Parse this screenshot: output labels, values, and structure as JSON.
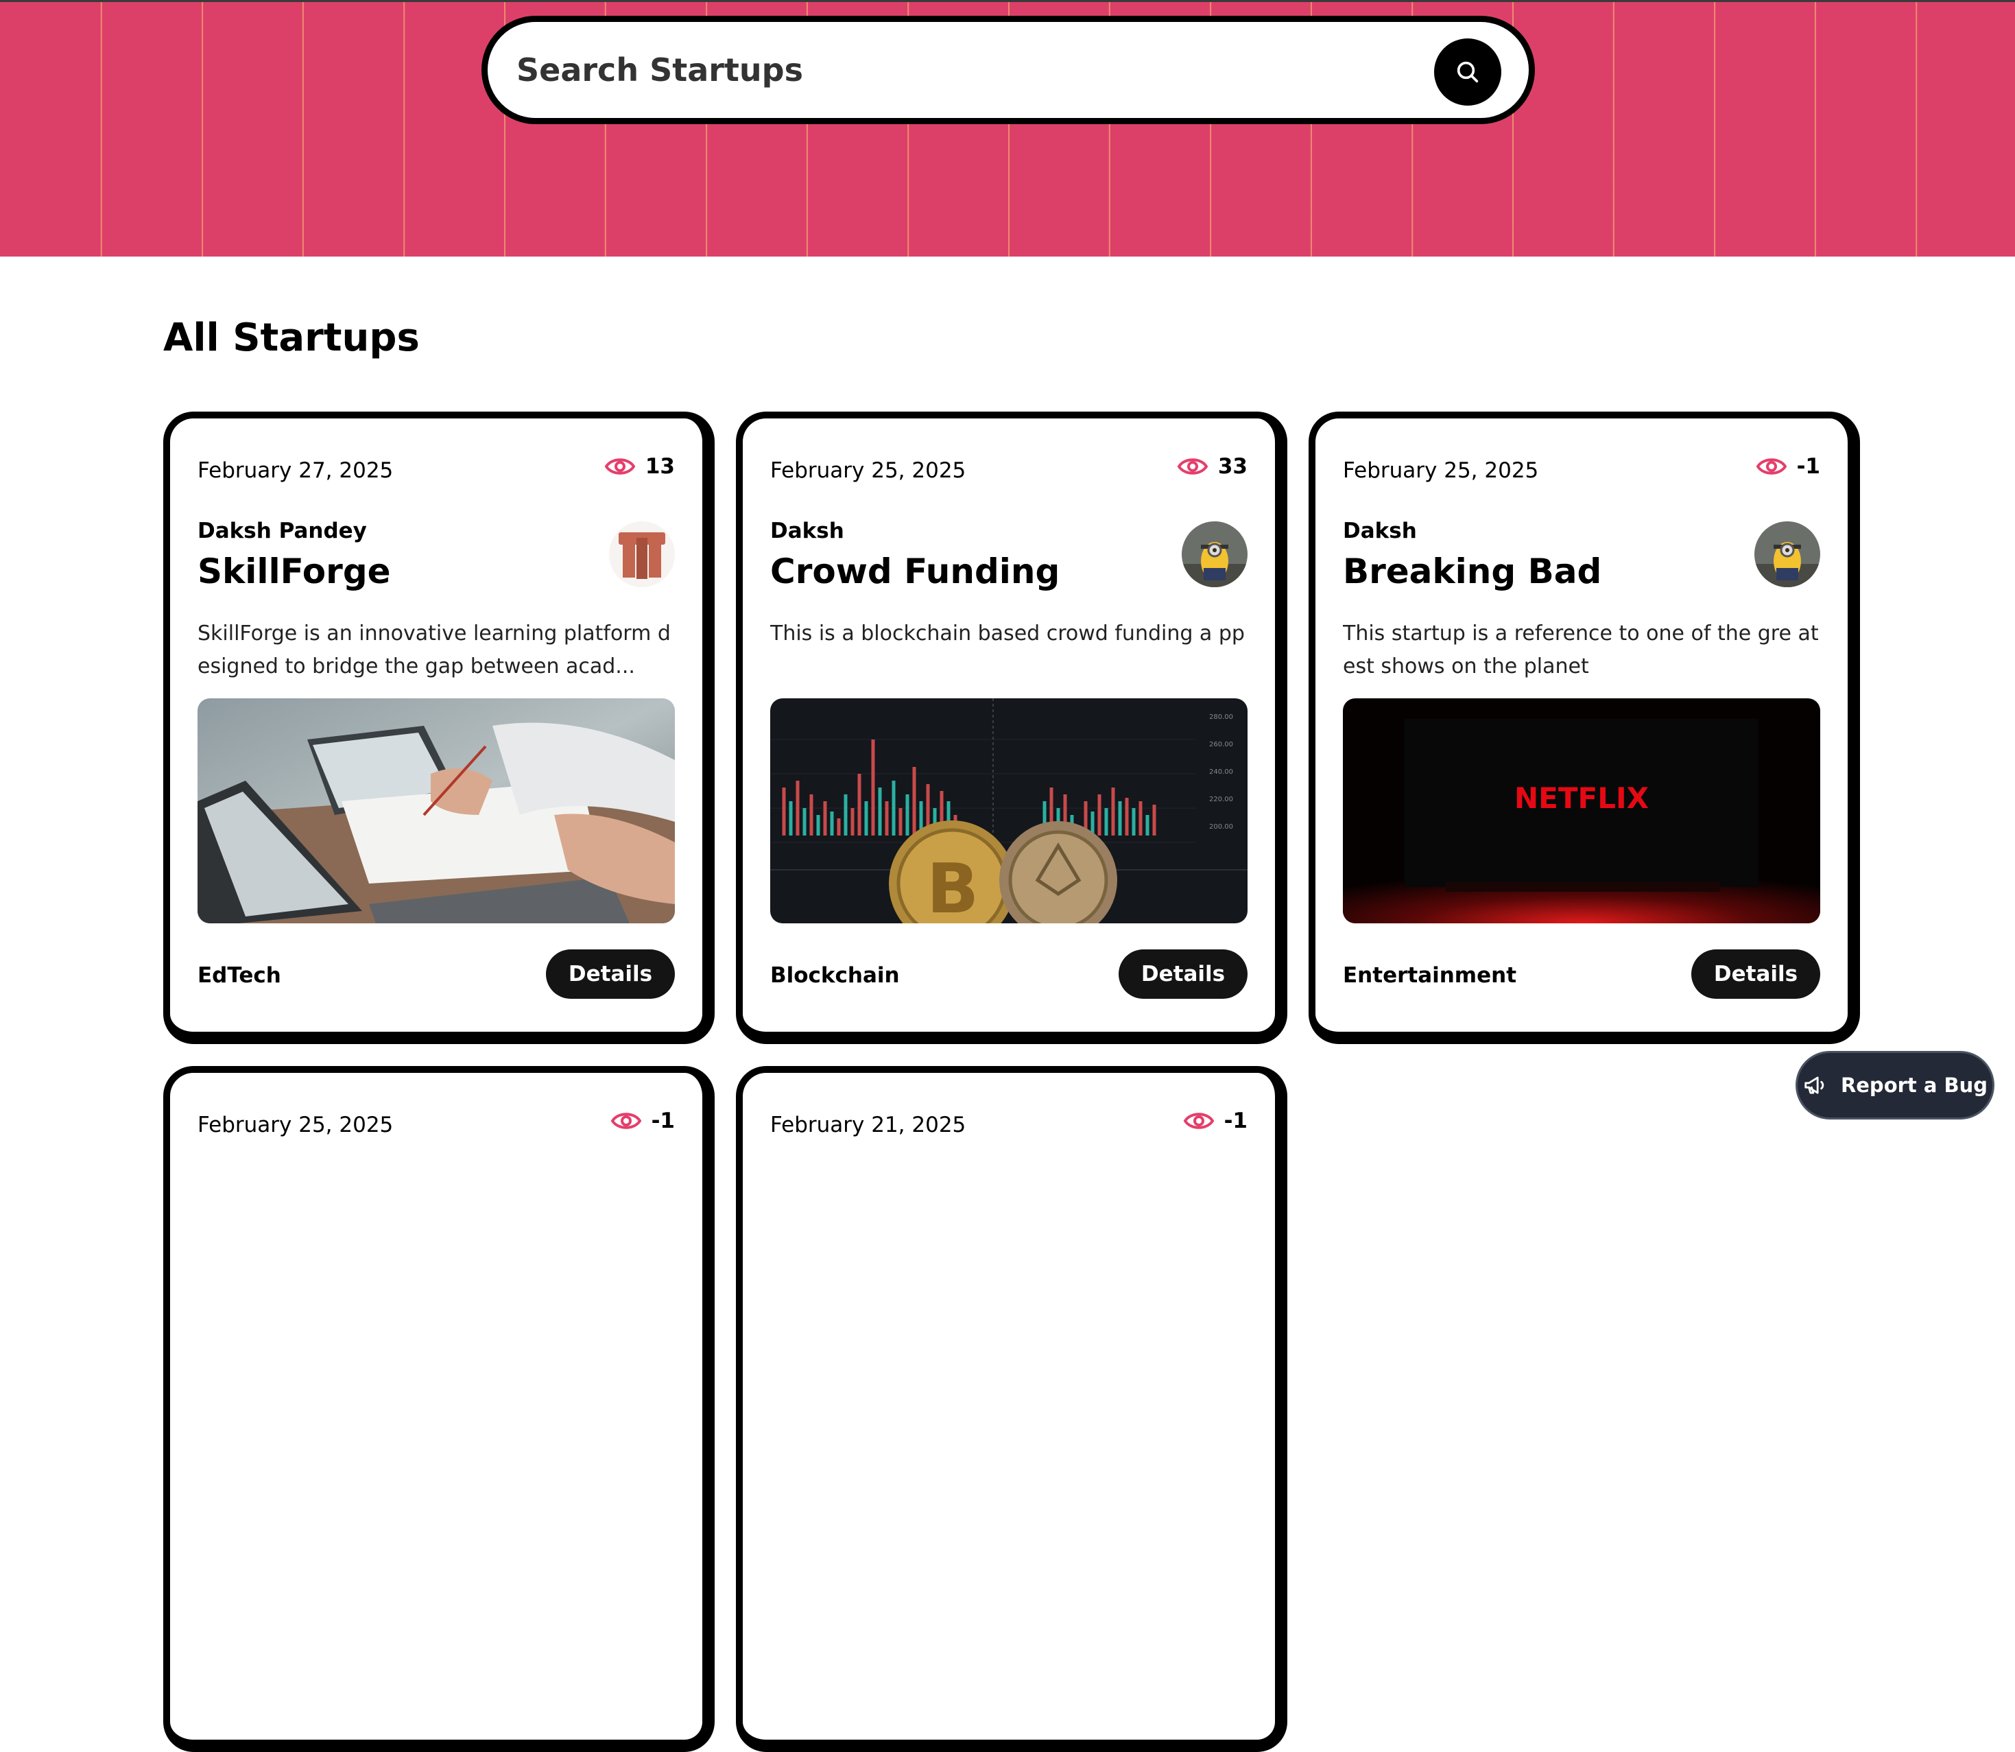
{
  "search": {
    "placeholder": "Search Startups",
    "button_icon": "search-icon"
  },
  "section": {
    "title": "All Startups"
  },
  "colors": {
    "hero_background": "#dc4068",
    "accent": "#e53e6b",
    "button": "#141414"
  },
  "startups": [
    {
      "date": "February 27, 2025",
      "views": "13",
      "author": "Daksh Pandey",
      "title": "SkillForge",
      "description": "SkillForge is an innovative learning platform designed to bridge the gap between acad...",
      "category": "EdTech",
      "details_label": "Details"
    },
    {
      "date": "February 25, 2025",
      "views": "33",
      "author": "Daksh",
      "title": "Crowd Funding",
      "description": "This is a blockchain based crowd funding a pp",
      "category": "Blockchain",
      "details_label": "Details"
    },
    {
      "date": "February 25, 2025",
      "views": "-1",
      "author": "Daksh",
      "title": "Breaking Bad",
      "description": "This startup is a reference to one of the gre atest shows on the planet",
      "category": "Entertainment",
      "details_label": "Details",
      "image_text": "NETFLIX"
    },
    {
      "date": "February 25, 2025",
      "views": "-1"
    },
    {
      "date": "February 21, 2025",
      "views": "-1"
    }
  ],
  "report_bug": {
    "label": "Report a Bug",
    "icon": "megaphone-icon"
  }
}
